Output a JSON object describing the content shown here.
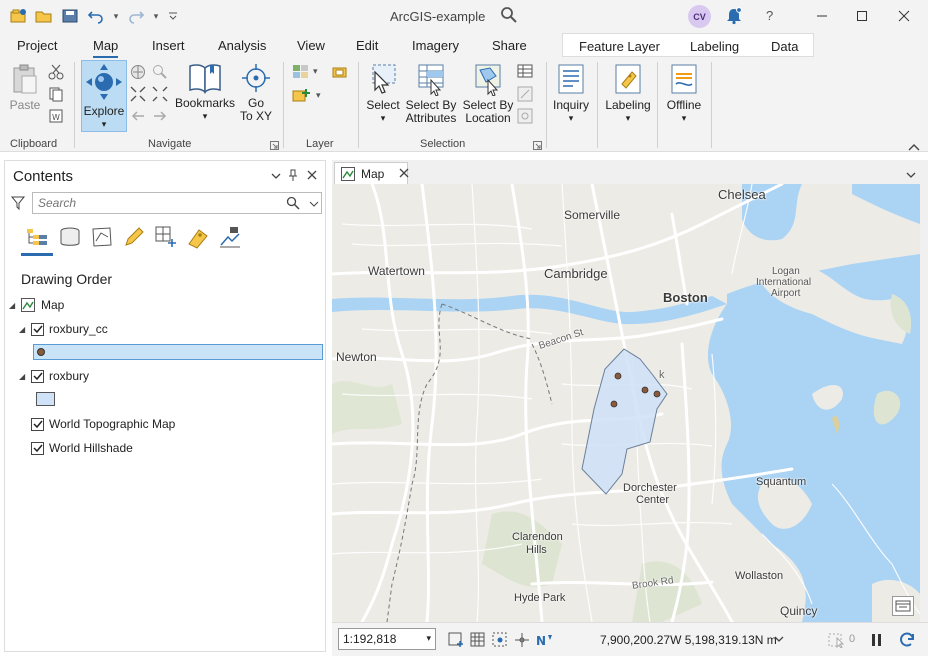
{
  "app": {
    "title": "ArcGIS-example",
    "user_initials": "CV",
    "help": "?"
  },
  "ribbon_tabs": [
    "Project",
    "Map",
    "Insert",
    "Analysis",
    "View",
    "Edit",
    "Imagery",
    "Share"
  ],
  "active_tab": "Map",
  "context_tabs": [
    "Feature Layer",
    "Labeling",
    "Data"
  ],
  "ribbon": {
    "clipboard": {
      "paste": "Paste",
      "group": "Clipboard"
    },
    "navigate": {
      "explore": "Explore",
      "bookmarks": "Bookmarks",
      "goto_line1": "Go",
      "goto_line2": "To XY",
      "group": "Navigate"
    },
    "layer": {
      "group": "Layer"
    },
    "selection": {
      "select": "Select",
      "by_attr_1": "Select By",
      "by_attr_2": "Attributes",
      "by_loc_1": "Select By",
      "by_loc_2": "Location",
      "group": "Selection"
    },
    "inquiry": "Inquiry",
    "labeling": "Labeling",
    "offline": "Offline"
  },
  "contents": {
    "title": "Contents",
    "search_placeholder": "Search",
    "drawing_order": "Drawing Order",
    "layers": {
      "map": "Map",
      "roxbury_cc": "roxbury_cc",
      "roxbury": "roxbury",
      "topo": "World Topographic Map",
      "hillshade": "World Hillshade"
    }
  },
  "mapview": {
    "tab_label": "Map",
    "scale": "1:192,818",
    "coordinates": "7,900,200.27W 5,198,319.13N m",
    "selected_count": "0"
  },
  "map_labels": {
    "chelsea": "Chelsea",
    "somerville": "Somerville",
    "watertown": "Watertown",
    "cambridge": "Cambridge",
    "boston": "Boston",
    "logan": "Logan",
    "international": "International",
    "airport": "Airport",
    "newton": "Newton",
    "beacon": "Beacon St",
    "dorchester": "Dorchester",
    "center": "Center",
    "squantum": "Squantum",
    "clarendon": "Clarendon",
    "hills": "Hills",
    "brook": "Brook Rd",
    "hydepark": "Hyde Park",
    "wollaston": "Wollaston",
    "quincy": "Quincy",
    "pk": "k"
  },
  "colors": {
    "accent": "#2b6cb0",
    "water": "#aad3f4",
    "land": "#ecebe6",
    "polygon_fill": "#cfe2f7",
    "polygon_stroke": "#6b7f9a",
    "point": "#8b5a3c"
  }
}
